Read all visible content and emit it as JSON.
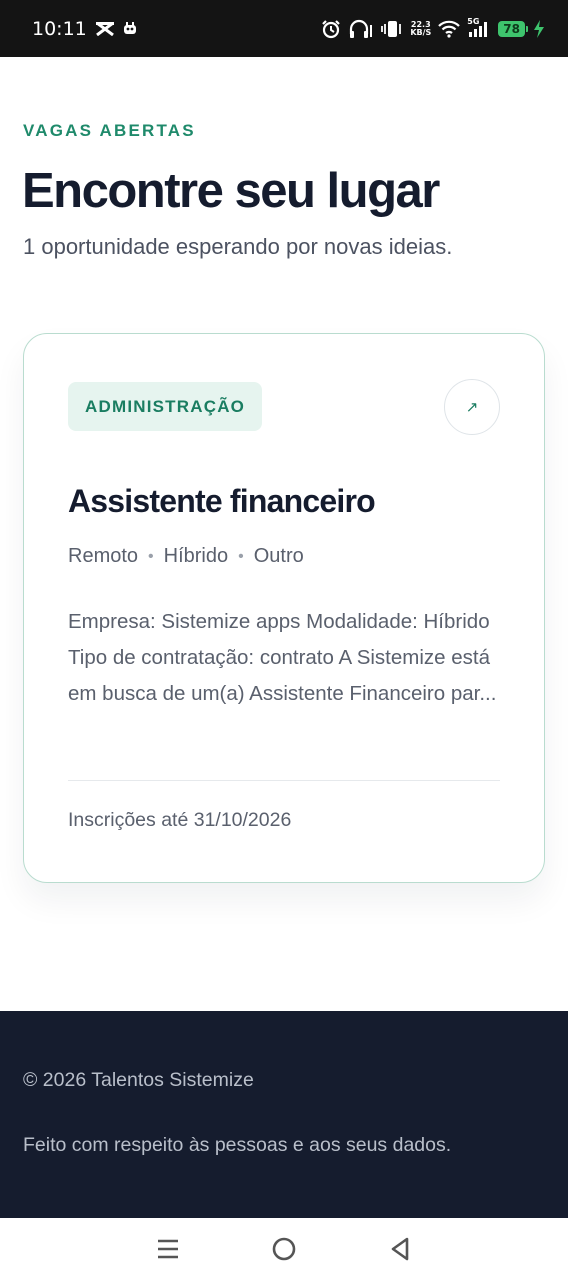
{
  "status_bar": {
    "time": "10:11",
    "network_speed_value": "22.3",
    "network_speed_unit": "KB/S",
    "signal_label": "5G",
    "battery_level": "78"
  },
  "hero": {
    "eyebrow": "VAGAS ABERTAS",
    "title": "Encontre seu lugar",
    "subtitle": "1 oportunidade esperando por novas ideias."
  },
  "job_card": {
    "category": "ADMINISTRAÇÃO",
    "open_icon": "↗",
    "title": "Assistente financeiro",
    "meta": [
      "Remoto",
      "Híbrido",
      "Outro"
    ],
    "description": "Empresa: Sistemize apps Modalidade: Híbrido Tipo de contratação: contrato A Sistemize está em busca de um(a) Assistente Financeiro par...",
    "deadline": "Inscrições até 31/10/2026"
  },
  "footer": {
    "copyright": "© 2026 Talentos Sistemize",
    "tagline": "Feito com respeito às pessoas e aos seus dados."
  },
  "colors": {
    "accent": "#1f8a6b",
    "heading": "#151c2e",
    "footer_bg": "#151c2e",
    "tag_bg": "#e6f4ef",
    "card_border": "#b9dccf"
  },
  "icons": {
    "status_left": [
      "notification-x-icon",
      "notification-app-icon"
    ],
    "status_right": [
      "alarm-icon",
      "headphones-icon",
      "vibrate-icon",
      "wifi-icon",
      "signal-icon",
      "battery-icon",
      "charging-icon"
    ],
    "nav": [
      "recents-icon",
      "home-icon",
      "back-icon"
    ]
  }
}
